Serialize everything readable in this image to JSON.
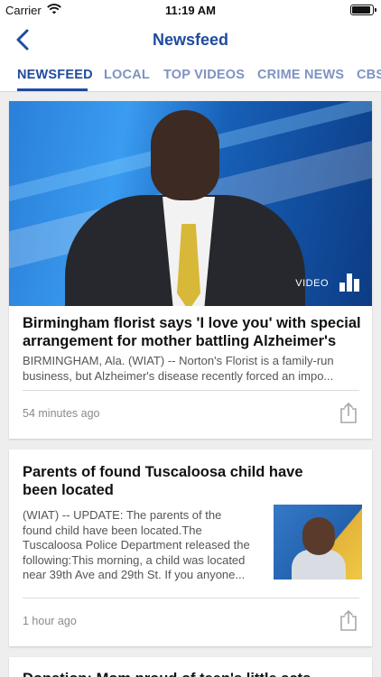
{
  "status_bar": {
    "carrier": "Carrier",
    "time": "11:19 AM"
  },
  "nav": {
    "title": "Newsfeed"
  },
  "tabs": [
    {
      "label": "NEWSFEED",
      "active": true
    },
    {
      "label": "LOCAL",
      "active": false
    },
    {
      "label": "TOP VIDEOS",
      "active": false
    },
    {
      "label": "CRIME NEWS",
      "active": false
    },
    {
      "label": "CBS",
      "active": false
    }
  ],
  "articles": [
    {
      "media_label": "VIDEO",
      "headline_lines": [
        "Birmingham florist says 'I love you' with special",
        "arrangement for mother battling Alzheimer's"
      ],
      "summary_lines": [
        "BIRMINGHAM, Ala. (WIAT) -- Norton's Florist is a family-run",
        "business, but Alzheimer's disease recently forced an impo..."
      ],
      "time_ago": "54 minutes ago"
    },
    {
      "headline_lines": [
        "Parents of found Tuscaloosa child have",
        "been located"
      ],
      "summary_lines": [
        "(WIAT) -- UPDATE: The parents of the",
        "found child have been located.The",
        "Tuscaloosa Police Department released the",
        "following:This morning, a child was located",
        "near 39th Ave and 29th St. If you anyone..."
      ],
      "time_ago": "1 hour ago"
    },
    {
      "headline_lines": [
        "Donation: Mom proud of teen's little acts..."
      ]
    }
  ],
  "colors": {
    "accent": "#1f4b9e",
    "tab_inactive": "#7e93c2"
  }
}
